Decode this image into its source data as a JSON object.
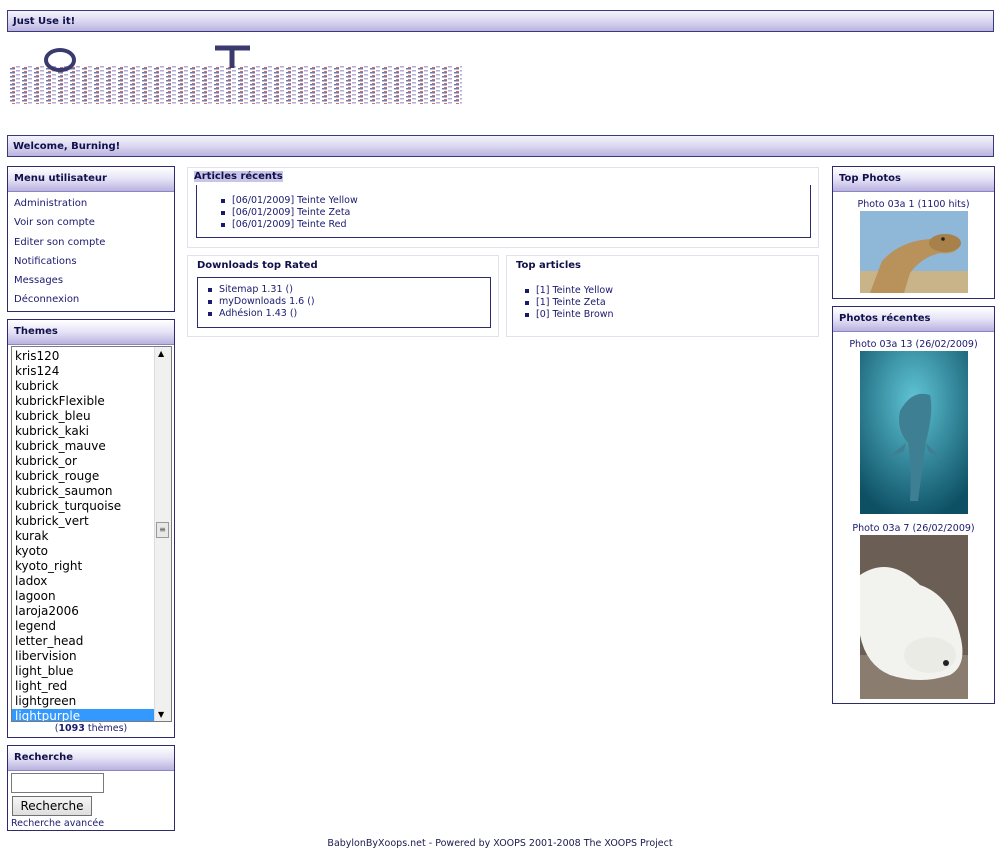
{
  "header": {
    "site_title": "Just Use it!",
    "welcome": "Welcome, Burning!"
  },
  "user_menu": {
    "title": "Menu utilisateur",
    "items": [
      "Administration",
      "Voir son compte",
      "Editer son compte",
      "Notifications",
      "Messages",
      "Déconnexion"
    ]
  },
  "themes": {
    "title": "Themes",
    "items": [
      "kris120",
      "kris124",
      "kubrick",
      "kubrickFlexible",
      "kubrick_bleu",
      "kubrick_kaki",
      "kubrick_mauve",
      "kubrick_or",
      "kubrick_rouge",
      "kubrick_saumon",
      "kubrick_turquoise",
      "kubrick_vert",
      "kurak",
      "kyoto",
      "kyoto_right",
      "ladox",
      "lagoon",
      "laroja2006",
      "legend",
      "letter_head",
      "libervision",
      "light_blue",
      "light_red",
      "lightgreen",
      "lightpurple"
    ],
    "selected": "lightpurple",
    "count_open": "(",
    "count": "1093",
    "count_label": " thèmes)"
  },
  "search": {
    "title": "Recherche",
    "input_value": "",
    "button_label": "Recherche",
    "advanced_link": "Recherche avancée"
  },
  "recent_articles": {
    "title": "Articles récents",
    "items": [
      "[06/01/2009] Teinte Yellow",
      "[06/01/2009] Teinte Zeta",
      "[06/01/2009] Teinte Red"
    ]
  },
  "downloads_top_rated": {
    "title": "Downloads top Rated",
    "items": [
      "Sitemap 1.31 ()",
      "myDownloads 1.6 ()",
      "Adhésion 1.43 ()"
    ]
  },
  "top_articles": {
    "title": "Top articles",
    "items": [
      "[1] Teinte Yellow",
      "[1] Teinte Zeta",
      "[0] Teinte Brown"
    ]
  },
  "top_photos": {
    "title": "Top Photos",
    "items": [
      {
        "caption": "Photo 03a 1 (1100 hits)",
        "icon": "camel-photo"
      }
    ]
  },
  "recent_photos": {
    "title": "Photos récentes",
    "items": [
      {
        "caption": "Photo 03a 13 (26/02/2009)",
        "icon": "dolphin-photo"
      },
      {
        "caption": "Photo 03a 7 (26/02/2009)",
        "icon": "polar-bear-photo"
      }
    ]
  },
  "footer": {
    "text": "BabylonByXoops.net - Powered by XOOPS 2001-2008 The XOOPS Project"
  },
  "colors": {
    "accent_dark": "#2b2b6e",
    "title_gradient_end": "#b9b2e0",
    "selected_item": "#3399ff"
  }
}
